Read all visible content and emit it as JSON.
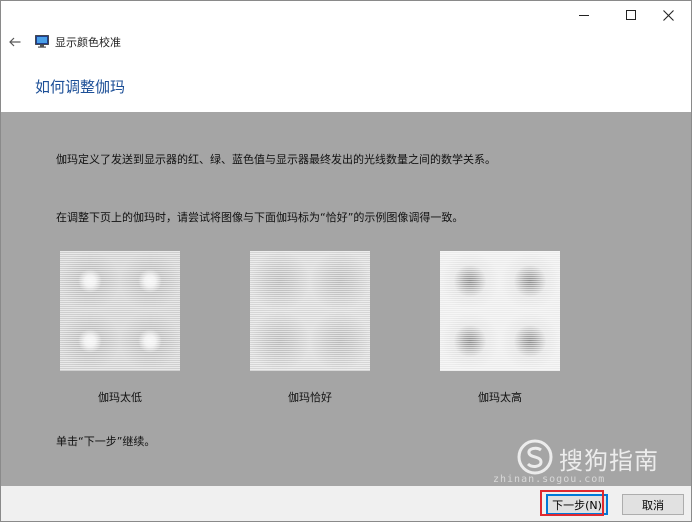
{
  "window": {
    "app_title": "显示颜色校准",
    "controls": {
      "minimize": "minimize",
      "maximize": "maximize",
      "close": "close"
    }
  },
  "page": {
    "heading": "如何调整伽玛",
    "description": "伽玛定义了发送到显示器的红、绿、蓝色值与显示器最终发出的光线数量之间的数学关系。",
    "instruction": "在调整下页上的伽玛时，请尝试将图像与下面伽玛标为“恰好”的示例图像调得一致。",
    "continue_hint": "单击“下一步”继续。"
  },
  "samples": [
    {
      "label": "伽玛太低",
      "kind": "low"
    },
    {
      "label": "伽玛恰好",
      "kind": "ok"
    },
    {
      "label": "伽玛太高",
      "kind": "high"
    }
  ],
  "buttons": {
    "next": "下一步(N)",
    "cancel": "取消"
  },
  "watermark": {
    "text": "搜狗指南",
    "url": "zhinan.sogou.com"
  },
  "colors": {
    "heading": "#1c4f97",
    "panel": "#a5a5a5",
    "footer": "#f0f0f0",
    "highlight": "#e0282f",
    "focus": "#0078d7"
  },
  "icons": {
    "back": "arrow-left-icon",
    "app": "monitor-icon",
    "minimize": "minimize-icon",
    "maximize": "maximize-icon",
    "close": "close-icon"
  }
}
